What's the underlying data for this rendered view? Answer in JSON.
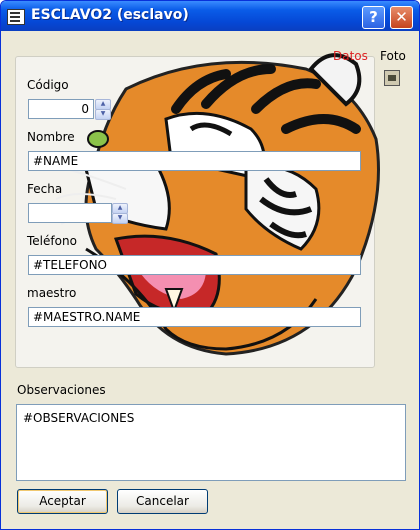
{
  "window": {
    "title": "ESCLAVO2 (esclavo)",
    "help_glyph": "?",
    "close_glyph": "✕"
  },
  "tabs": {
    "datos": "Datos",
    "foto": "Foto",
    "active": "Datos",
    "active_color": "#dd2222"
  },
  "form": {
    "codigo_label": "Código",
    "codigo_value": "0",
    "nombre_label": "Nombre",
    "nombre_value": "#NAME",
    "fecha_label": "Fecha",
    "fecha_value": "",
    "telefono_label": "Teléfono",
    "telefono_value": "#TELEFONO",
    "maestro_label": "maestro",
    "maestro_value": "#MAESTRO.NAME"
  },
  "observaciones": {
    "label": "Observaciones",
    "value": "#OBSERVACIONES"
  },
  "buttons": {
    "accept": "Aceptar",
    "cancel": "Cancelar"
  }
}
